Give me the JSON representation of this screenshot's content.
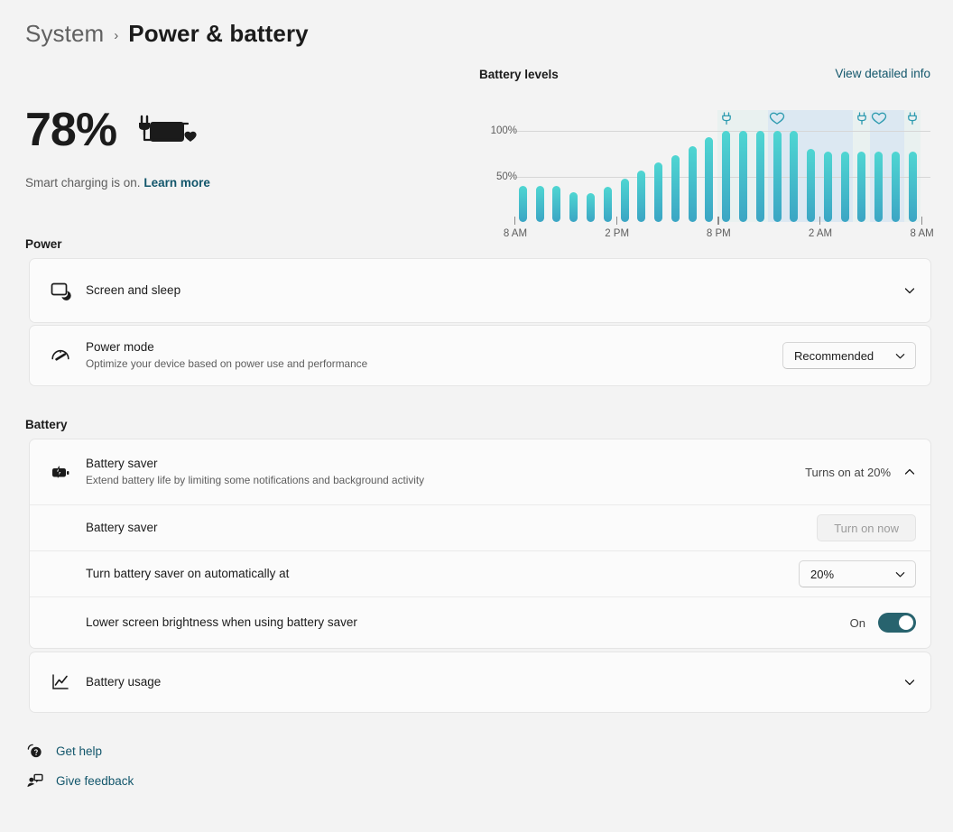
{
  "breadcrumb": {
    "parent": "System",
    "separator": "›",
    "current": "Power & battery"
  },
  "battery_summary": {
    "percent": "78%",
    "icon": "battery-charging-smart-icon",
    "status_text": "Smart charging is on.",
    "learn_more": "Learn more"
  },
  "chart_panel": {
    "title": "Battery levels",
    "detail_link": "View detailed info"
  },
  "chart_data": {
    "type": "bar",
    "title": "Battery levels",
    "xlabel": "",
    "ylabel": "",
    "ylim": [
      0,
      110
    ],
    "yticks": [
      50,
      100
    ],
    "ytick_labels": [
      "50%",
      "100%"
    ],
    "grid": true,
    "legend": "none",
    "x": [
      "8 AM",
      "9 AM",
      "10 AM",
      "11 AM",
      "12 PM",
      "1 PM",
      "2 PM",
      "3 PM",
      "4 PM",
      "5 PM",
      "6 PM",
      "7 PM",
      "8 PM",
      "9 PM",
      "10 PM",
      "11 PM",
      "12 AM",
      "1 AM",
      "2 AM",
      "3 AM",
      "4 AM",
      "5 AM",
      "6 AM",
      "7 AM"
    ],
    "xticks": [
      "8 AM",
      "2 PM",
      "8 PM",
      "2 AM",
      "8 AM"
    ],
    "xtick_positions": [
      0,
      6,
      12,
      18,
      24
    ],
    "values": [
      40,
      40,
      40,
      33,
      32,
      39,
      48,
      56,
      65,
      73,
      83,
      93,
      100,
      100,
      100,
      100,
      100,
      80,
      77,
      77,
      77,
      77,
      77,
      77
    ],
    "bar_gradient": [
      "#4fd6d2",
      "#3ba5c4"
    ],
    "annotations": [
      {
        "icon": "plug-icon",
        "at_index": 12,
        "label": "Plugged in"
      },
      {
        "icon": "heart-icon",
        "at_index": 15,
        "label": "Smart charging"
      },
      {
        "icon": "plug-icon",
        "at_index": 20,
        "label": "Plugged in"
      },
      {
        "icon": "heart-icon",
        "at_index": 21,
        "label": "Smart charging"
      },
      {
        "icon": "plug-icon",
        "at_index": 23,
        "label": "Plugged in"
      }
    ],
    "shaded_bands": [
      {
        "start_index": 12,
        "end_index": 15,
        "tint": "#e9f1f0",
        "type": "plugged"
      },
      {
        "start_index": 15,
        "end_index": 20,
        "tint": "#dce8f2",
        "type": "smart-charging"
      },
      {
        "start_index": 20,
        "end_index": 21,
        "tint": "#e9f1f0",
        "type": "plugged"
      },
      {
        "start_index": 21,
        "end_index": 23,
        "tint": "#dce8f2",
        "type": "smart-charging"
      },
      {
        "start_index": 23,
        "end_index": 24,
        "tint": "#e9f1f0",
        "type": "plugged"
      }
    ]
  },
  "sections": {
    "power": {
      "header": "Power"
    },
    "battery": {
      "header": "Battery"
    }
  },
  "rows": {
    "screen_and_sleep": {
      "icon": "monitor-sleep-icon",
      "title": "Screen and sleep",
      "chevron": "chevron-down-icon"
    },
    "power_mode": {
      "icon": "gauge-icon",
      "title": "Power mode",
      "subtitle": "Optimize your device based on power use and performance",
      "value": "Recommended",
      "chevron": "chevron-down-icon"
    },
    "battery_saver": {
      "icon": "battery-saver-icon",
      "title": "Battery saver",
      "subtitle": "Extend battery life by limiting some notifications and background activity",
      "status": "Turns on at 20%",
      "chevron": "chevron-up-icon"
    },
    "battery_saver_toggle_row": {
      "title": "Battery saver",
      "button_label": "Turn on now",
      "button_enabled": false
    },
    "auto_threshold": {
      "title": "Turn battery saver on automatically at",
      "value": "20%",
      "chevron": "chevron-down-icon"
    },
    "lower_brightness": {
      "title": "Lower screen brightness when using battery saver",
      "toggle_label": "On",
      "toggle_state": "on"
    },
    "battery_usage": {
      "icon": "line-chart-icon",
      "title": "Battery usage",
      "chevron": "chevron-down-icon"
    }
  },
  "footer": {
    "links": [
      {
        "icon": "help-icon",
        "label": "Get help"
      },
      {
        "icon": "feedback-icon",
        "label": "Give feedback"
      }
    ]
  },
  "colors": {
    "accent_link": "#12566b",
    "toggle_on": "#28636e",
    "bar_top": "#4fd6d2",
    "bar_bottom": "#3ba5c4",
    "page_bg": "#f3f3f3",
    "card_bg": "#fbfbfb"
  }
}
